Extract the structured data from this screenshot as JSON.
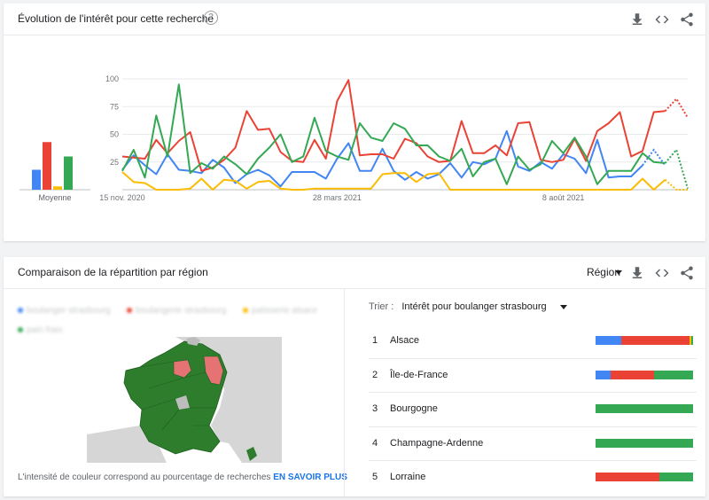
{
  "colors": {
    "blue": "#4285f4",
    "red": "#ea4335",
    "yellow": "#fbbc04",
    "green": "#34a853",
    "map_green": "#2d7d2d",
    "map_red": "#e57373",
    "map_gray": "#bdbdbd",
    "map_sea": "#ffffff"
  },
  "card1": {
    "title": "Évolution de l'intérêt pour cette recherche",
    "help_icon": "?",
    "icons": [
      "download-icon",
      "embed-icon",
      "share-icon"
    ]
  },
  "card2": {
    "title": "Comparaison de la répartition par région",
    "region_label": "Région",
    "legend": [
      {
        "label": "boulanger strasbourg",
        "color": "#4285f4"
      },
      {
        "label": "boulangerie strasbourg",
        "color": "#ea4335"
      },
      {
        "label": "patisserie alsace",
        "color": "#fbbc04"
      },
      {
        "label": "pain frais",
        "color": "#34a853"
      }
    ],
    "footnote_text": "L'intensité de couleur correspond au pourcentage de recherches",
    "footnote_link": "EN SAVOIR PLUS",
    "sort_label": "Trier :",
    "sort_value": "Intérêt pour boulanger strasbourg",
    "regions": [
      {
        "rank": "1",
        "name": "Alsace",
        "shares": [
          0.26,
          0.7,
          0.02,
          0.02
        ]
      },
      {
        "rank": "2",
        "name": "Île-de-France",
        "shares": [
          0.15,
          0.45,
          0.0,
          0.4
        ]
      },
      {
        "rank": "3",
        "name": "Bourgogne",
        "shares": [
          0.0,
          0.0,
          0.0,
          1.0
        ]
      },
      {
        "rank": "4",
        "name": "Champagne-Ardenne",
        "shares": [
          0.0,
          0.0,
          0.0,
          1.0
        ]
      },
      {
        "rank": "5",
        "name": "Lorraine",
        "shares": [
          0.0,
          0.65,
          0.0,
          0.35
        ]
      }
    ]
  },
  "chart_data": [
    {
      "type": "bar",
      "title": "Moyenne",
      "categories": [
        "boulanger strasbourg",
        "boulangerie strasbourg",
        "patisserie alsace",
        "pain frais"
      ],
      "values": [
        18,
        43,
        3,
        30
      ],
      "ylim": [
        0,
        100
      ]
    },
    {
      "type": "line",
      "x_ticks": [
        "15 nov. 2020",
        "28 mars 2021",
        "8 août 2021"
      ],
      "x_tick_index": [
        0,
        19,
        39
      ],
      "y_ticks": [
        25,
        50,
        75,
        100
      ],
      "ylim": [
        0,
        100
      ],
      "grid": true,
      "series": [
        {
          "name": "boulanger strasbourg",
          "color": "#4285f4",
          "values": [
            18,
            31,
            22,
            14,
            32,
            18,
            17,
            15,
            27,
            20,
            6,
            14,
            18,
            13,
            3,
            16,
            16,
            16,
            10,
            28,
            42,
            17,
            17,
            37,
            17,
            9,
            16,
            10,
            14,
            24,
            11,
            25,
            23,
            28,
            53,
            21,
            17,
            25,
            19,
            32,
            28,
            15,
            45,
            11,
            12,
            12,
            22,
            36,
            22
          ]
        },
        {
          "name": "boulangerie strasbourg",
          "color": "#ea4335",
          "values": [
            30,
            29,
            28,
            45,
            33,
            44,
            52,
            17,
            20,
            27,
            38,
            71,
            54,
            55,
            34,
            26,
            25,
            45,
            28,
            80,
            99,
            31,
            32,
            32,
            28,
            46,
            42,
            30,
            25,
            26,
            62,
            33,
            33,
            40,
            31,
            60,
            61,
            27,
            25,
            27,
            46,
            26,
            53,
            60,
            70,
            30,
            35,
            70,
            71,
            82,
            65
          ]
        },
        {
          "name": "patisserie alsace",
          "color": "#fbbc04",
          "values": [
            16,
            7,
            6,
            0,
            0,
            0,
            1,
            10,
            0,
            9,
            8,
            1,
            7,
            8,
            1,
            0,
            0,
            1,
            1,
            1,
            1,
            1,
            1,
            14,
            15,
            15,
            7,
            14,
            15,
            0,
            0,
            0,
            0,
            0,
            0,
            0,
            0,
            0,
            0,
            0,
            0,
            0,
            0,
            0,
            0,
            0,
            10,
            0,
            9,
            0,
            0
          ]
        },
        {
          "name": "pain frais",
          "color": "#34a853",
          "values": [
            17,
            36,
            11,
            67,
            30,
            95,
            15,
            24,
            19,
            30,
            23,
            14,
            28,
            38,
            50,
            25,
            30,
            65,
            35,
            30,
            27,
            60,
            47,
            44,
            60,
            55,
            40,
            40,
            30,
            26,
            37,
            12,
            25,
            28,
            5,
            30,
            18,
            23,
            44,
            33,
            47,
            30,
            5,
            17,
            17,
            17,
            33,
            25,
            24,
            36,
            1
          ]
        }
      ]
    }
  ]
}
